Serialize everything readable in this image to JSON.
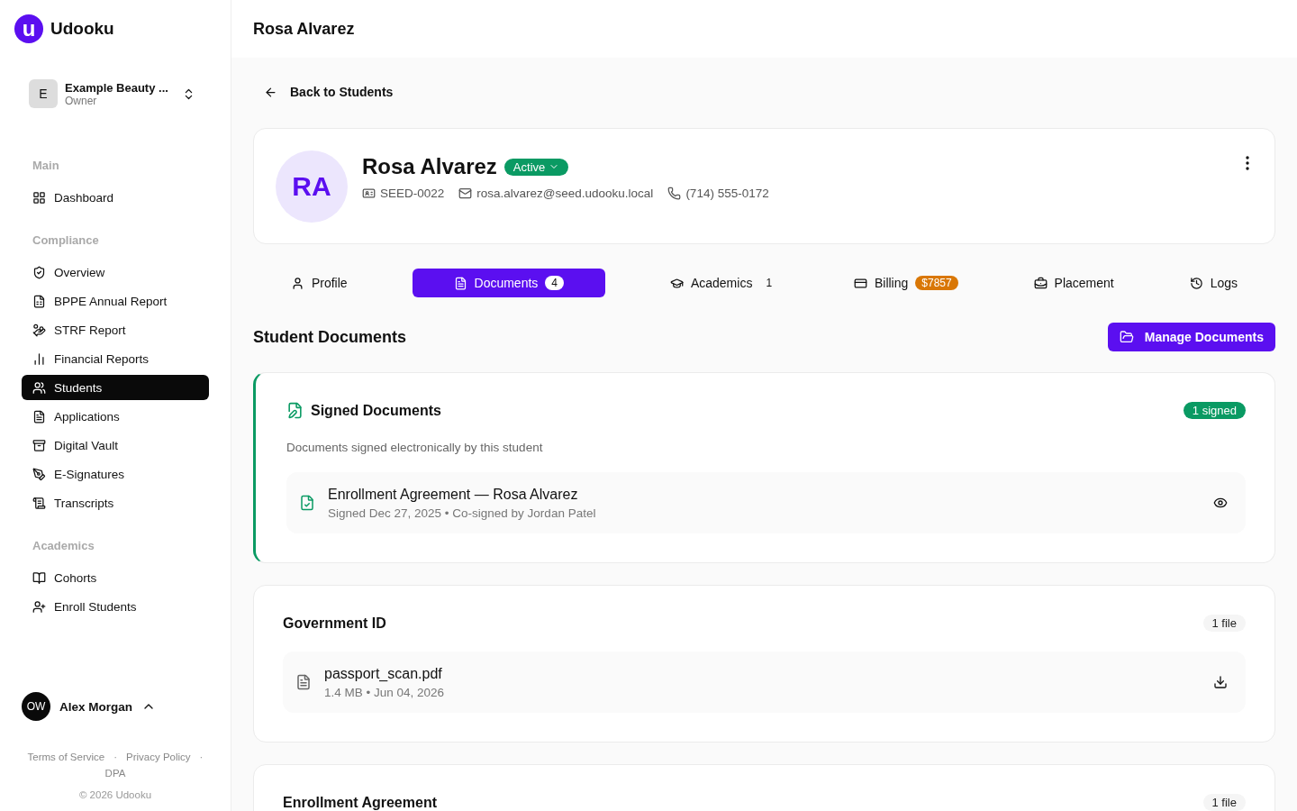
{
  "brand": {
    "mark": "u",
    "name": "Udooku"
  },
  "workspace": {
    "initial": "E",
    "name": "Example Beauty ...",
    "role": "Owner"
  },
  "sidebar": {
    "sections": [
      {
        "title": "Main",
        "items": [
          {
            "label": "Dashboard",
            "selected": false
          }
        ]
      },
      {
        "title": "Compliance",
        "items": [
          {
            "label": "Overview",
            "selected": false
          },
          {
            "label": "BPPE Annual Report",
            "selected": false
          },
          {
            "label": "STRF Report",
            "selected": false
          },
          {
            "label": "Financial Reports",
            "selected": false
          },
          {
            "label": "Students",
            "selected": true
          },
          {
            "label": "Applications",
            "selected": false
          },
          {
            "label": "Digital Vault",
            "selected": false
          },
          {
            "label": "E-Signatures",
            "selected": false
          },
          {
            "label": "Transcripts",
            "selected": false
          }
        ]
      },
      {
        "title": "Academics",
        "items": [
          {
            "label": "Cohorts",
            "selected": false
          },
          {
            "label": "Enroll Students",
            "selected": false
          }
        ]
      }
    ]
  },
  "user": {
    "initials": "OW",
    "name": "Alex Morgan"
  },
  "footer": {
    "links": [
      "Terms of Service",
      "Privacy Policy",
      "DPA"
    ],
    "separator": "·",
    "copyright": "© 2026 Udooku"
  },
  "header": {
    "title": "Rosa Alvarez"
  },
  "back_link": "Back to Students",
  "student": {
    "initials": "RA",
    "name": "Rosa Alvarez",
    "status": "Active",
    "id": "SEED-0022",
    "email": "rosa.alvarez@seed.udooku.local",
    "phone": "(714) 555-0172"
  },
  "tabs": [
    {
      "label": "Profile",
      "selected": false
    },
    {
      "label": "Documents",
      "selected": true,
      "badge": {
        "text": "4",
        "kind": "count"
      }
    },
    {
      "label": "Academics",
      "selected": false,
      "badge": {
        "text": "1",
        "kind": "count"
      }
    },
    {
      "label": "Billing",
      "selected": false,
      "badge": {
        "text": "$7857",
        "kind": "warning"
      }
    },
    {
      "label": "Placement",
      "selected": false
    },
    {
      "label": "Logs",
      "selected": false
    }
  ],
  "section_title": "Student Documents",
  "manage_button": "Manage Documents",
  "document_groups": [
    {
      "kind": "signed",
      "title": "Signed Documents",
      "badge": "1 signed",
      "description": "Documents signed electronically by this student",
      "files": [
        {
          "name": "Enrollment Agreement — Rosa Alvarez",
          "meta": "Signed Dec 27, 2025 • Co-signed by Jordan Patel",
          "kind": "signed"
        }
      ]
    },
    {
      "kind": "files",
      "title": "Government ID",
      "badge": "1 file",
      "files": [
        {
          "name": "passport_scan.pdf",
          "meta": "1.4 MB • Jun 04, 2026",
          "kind": "upload"
        }
      ]
    },
    {
      "kind": "files",
      "title": "Enrollment Agreement",
      "badge": "1 file"
    }
  ]
}
